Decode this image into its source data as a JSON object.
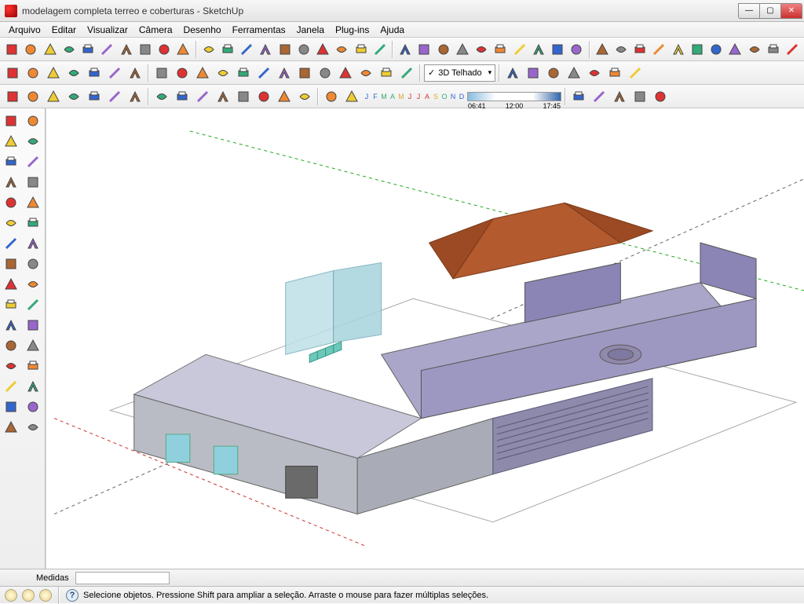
{
  "window": {
    "title": "modelagem completa terreo e coberturas - SketchUp",
    "buttons": {
      "min": "—",
      "max": "▢",
      "close": "✕"
    }
  },
  "menu": [
    "Arquivo",
    "Editar",
    "Visualizar",
    "Câmera",
    "Desenho",
    "Ferramentas",
    "Janela",
    "Plug-ins",
    "Ajuda"
  ],
  "row2": {
    "dropdown": "3D Telhado",
    "dropdown_check": "✓"
  },
  "row3": {
    "months": [
      "J",
      "F",
      "M",
      "A",
      "M",
      "J",
      "J",
      "A",
      "S",
      "O",
      "N",
      "D"
    ],
    "t1": "06:41",
    "t2": "12:00",
    "t3": "17:45"
  },
  "status": {
    "measure_label": "Medidas",
    "measure_value": ""
  },
  "hint": "Selecione objetos. Pressione Shift para ampliar a seleção. Arraste o mouse para fazer múltiplas seleções.",
  "icons": {
    "row1": [
      "line-tool-icon",
      "freehand-icon",
      "rectangle-icon",
      "circle-icon",
      "polygon-icon",
      "arc-icon",
      "pie-icon",
      "bezier-icon",
      "path-icon",
      "rect-rot-icon",
      "offset-path-icon",
      "pushpull-icon",
      "follow-me-icon",
      "move-3d-icon",
      "rotate-3d-icon",
      "scale-3d-icon",
      "dim-line-icon",
      "dim-angle-icon",
      "dim-edge-icon",
      "dim-path-icon",
      "wall-icon",
      "wall-join-icon",
      "wall-split-icon",
      "wall-corner-icon",
      "door-icon",
      "window-icon",
      "opening-icon",
      "profile-icon",
      "panel-icon",
      "railing-icon",
      "stair-icon",
      "column-icon",
      "beam-icon",
      "roof-icon",
      "roof-surface-icon",
      "roof-edge-icon",
      "slab-icon",
      "foundation-icon",
      "grid-icon",
      "hatch-icon",
      "pattern-icon"
    ],
    "row2": [
      "select-icon",
      "component-icon",
      "group-icon",
      "explode-icon",
      "outliner-icon",
      "geo-locate-icon",
      "stamp-icon",
      "box-solid-icon",
      "box-outline-icon",
      "box-front-icon",
      "box-shadow-icon",
      "solid-union-icon",
      "solid-subtract-icon",
      "solid-intersect-icon",
      "solid-trim-icon",
      "solid-split-icon",
      "texture-a-icon",
      "texture-b-icon",
      "texture-c-icon",
      "texture-d-icon",
      "info-model-icon",
      "house-wire-icon",
      "house-door-icon",
      "house-win-icon",
      "house-solid-icon",
      "save-view-icon",
      "folder-icon"
    ],
    "row3": [
      "sun-study-icon",
      "light-panel-icon",
      "bulb-icon",
      "disc-icon",
      "spot-icon",
      "sun-icon",
      "star-icon",
      "mat-wood-icon",
      "mat-tile-icon",
      "mat-stone-icon",
      "mat-grass-icon",
      "mat-metal-icon",
      "mat-glass-icon",
      "mat-brick-icon",
      "mat-conc-icon",
      "render-quick-icon",
      "render-full-icon",
      "globe-icon",
      "ball-green-icon",
      "ball-yellow-icon",
      "clipboard-icon",
      "ball-red-icon"
    ],
    "side": [
      "cursor-icon",
      "eraser-icon",
      "line-draw-icon",
      "pencil-icon",
      "rect-draw-icon",
      "pencil-red-icon",
      "circle-draw-icon",
      "arc-draw-icon",
      "polygon-draw-icon",
      "freehand-draw-icon",
      "move-icon",
      "pushpull-side-icon",
      "rotate-icon",
      "followme-side-icon",
      "scale-icon",
      "offset-icon",
      "tape-icon",
      "protractor-icon",
      "axes-icon",
      "text-label-icon",
      "dimension-icon",
      "text-3d-icon",
      "orbit-icon",
      "pan-icon",
      "zoom-icon",
      "zoom-window-icon",
      "prev-view-icon",
      "next-view-icon",
      "position-cam-icon",
      "look-around-icon",
      "walk-icon",
      "section-icon"
    ]
  }
}
